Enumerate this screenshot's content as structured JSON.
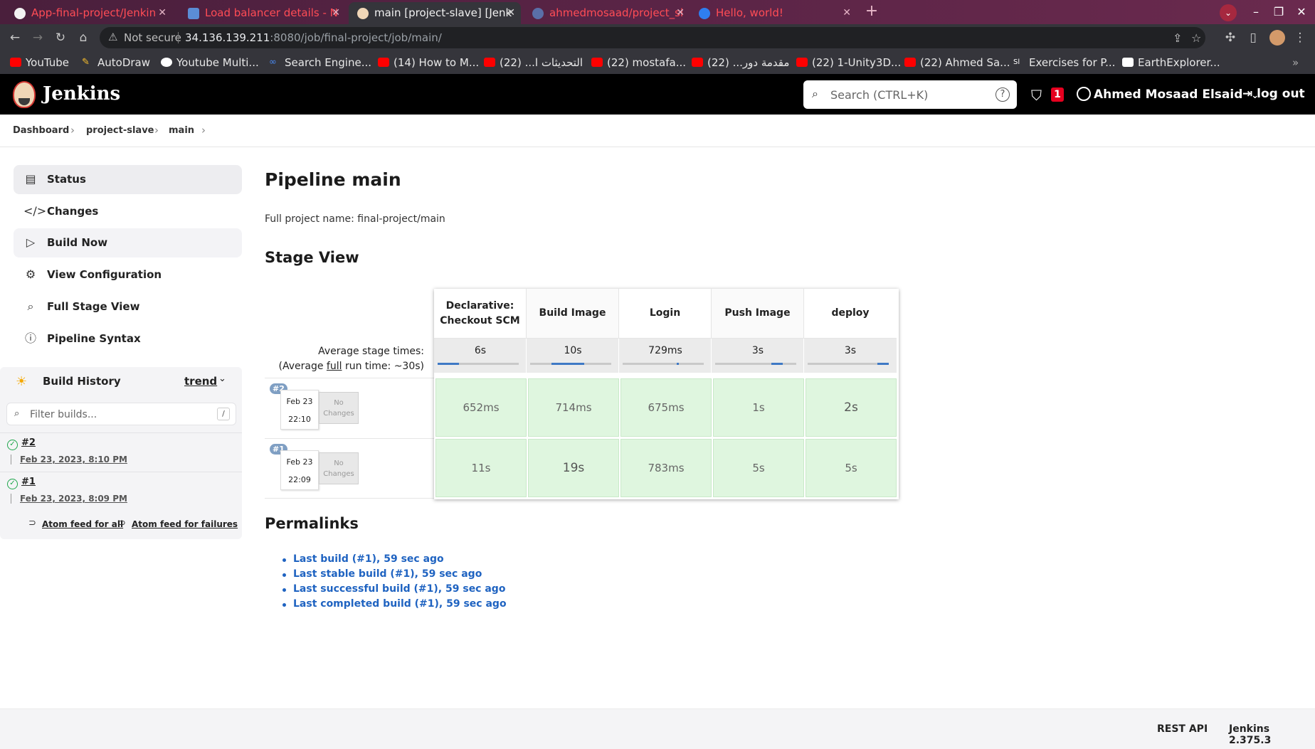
{
  "browser": {
    "tabs": [
      {
        "title": "App-final-project/Jenkin",
        "style": "red"
      },
      {
        "title": "Load balancer details - N",
        "style": "red"
      },
      {
        "title": "main [project-slave] [Jenk",
        "style": "active"
      },
      {
        "title": "ahmedmosaad/project_sl",
        "style": "red"
      },
      {
        "title": "Hello, world!",
        "style": "red"
      }
    ],
    "security_label": "Not secure",
    "url_host": "34.136.139.211",
    "url_rest": ":8080/job/final-project/job/main/",
    "bookmarks": [
      "YouTube",
      "AutoDraw",
      "Youtube Multi...",
      "Search Engine...",
      "(14) How to M...",
      "التحديثات ا... (22)",
      "(22) mostafa...",
      "مقدمة دور... (22)",
      "(22) 1-Unity3D...",
      "(22) Ahmed Sa...",
      "Exercises for P...",
      "EarthExplorer..."
    ]
  },
  "header": {
    "brand": "Jenkins",
    "search_placeholder": "Search (CTRL+K)",
    "help": "?",
    "security_count": "1",
    "user": "Ahmed Mosaad Elsaid",
    "logout": "log out"
  },
  "breadcrumb": [
    "Dashboard",
    "project-slave",
    "main"
  ],
  "sidebar": {
    "items": [
      {
        "label": "Status",
        "icon": "document-icon"
      },
      {
        "label": "Changes",
        "icon": "code-icon"
      },
      {
        "label": "Build Now",
        "icon": "play-icon"
      },
      {
        "label": "View Configuration",
        "icon": "gear-icon"
      },
      {
        "label": "Full Stage View",
        "icon": "search-icon"
      },
      {
        "label": "Pipeline Syntax",
        "icon": "help-icon"
      }
    ],
    "build_history": {
      "title": "Build History",
      "trend": "trend",
      "filter_placeholder": "Filter builds...",
      "filter_key": "/",
      "builds": [
        {
          "num": "#2",
          "date": "Feb 23, 2023, 8:10 PM"
        },
        {
          "num": "#1",
          "date": "Feb 23, 2023, 8:09 PM"
        }
      ],
      "feed_all": "Atom feed for all",
      "feed_failures": "Atom feed for failures"
    }
  },
  "main": {
    "title": "Pipeline main",
    "full_name": "Full project name: final-project/main",
    "stage_view_title": "Stage View",
    "avg_label_1": "Average stage times:",
    "avg_label_2a": "(Average ",
    "avg_label_2b": "full",
    "avg_label_2c": " run time: ~30s)",
    "stages": [
      {
        "name": "Declarative: Checkout SCM",
        "avg": "6s"
      },
      {
        "name": "Build Image",
        "avg": "10s"
      },
      {
        "name": "Login",
        "avg": "729ms"
      },
      {
        "name": "Push Image",
        "avg": "3s"
      },
      {
        "name": "deploy",
        "avg": "3s"
      }
    ],
    "runs": [
      {
        "badge": "#2",
        "date": "Feb 23",
        "time": "22:10",
        "changes": "No Changes",
        "durations": [
          "652ms",
          "714ms",
          "675ms",
          "1s",
          "2s"
        ]
      },
      {
        "badge": "#1",
        "date": "Feb 23",
        "time": "22:09",
        "changes": "No Changes",
        "durations": [
          "11s",
          "19s",
          "783ms",
          "5s",
          "5s"
        ]
      }
    ],
    "permalinks_title": "Permalinks",
    "permalinks": [
      "Last build (#1), 59 sec ago",
      "Last stable build (#1), 59 sec ago",
      "Last successful build (#1), 59 sec ago",
      "Last completed build (#1), 59 sec ago"
    ]
  },
  "footer": {
    "rest_api": "REST API",
    "version": "Jenkins 2.375.3"
  }
}
